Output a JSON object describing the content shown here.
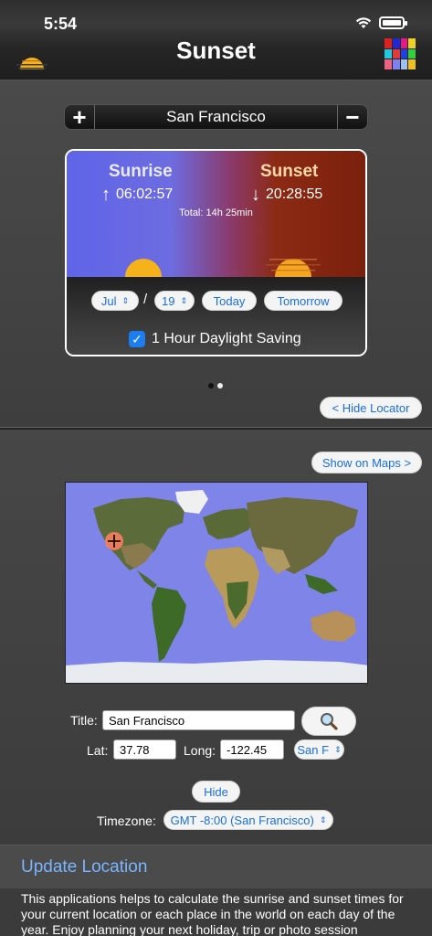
{
  "status": {
    "time": "5:54"
  },
  "nav": {
    "title": "Sunset"
  },
  "city": {
    "add_label": "+",
    "name": "San Francisco",
    "remove_label": "−"
  },
  "card": {
    "sunrise_label": "Sunrise",
    "sunrise_arrow": "↑",
    "sunrise_time": "06:02:57",
    "sunset_label": "Sunset",
    "sunset_arrow": "↓",
    "sunset_time": "20:28:55",
    "total": "Total: 14h 25min",
    "month": "Jul",
    "day": "19",
    "separator": "/",
    "today_label": "Today",
    "tomorrow_label": "Tomorrow",
    "dst_checked": true,
    "dst_label": "1 Hour Daylight Saving"
  },
  "page_indicator": {
    "count": 2,
    "current": 0
  },
  "hide_locator_label": "< Hide Locator",
  "show_on_maps_label": "Show on Maps >",
  "form": {
    "title_label": "Title:",
    "title_value": "San Francisco",
    "lat_label": "Lat:",
    "lat_value": "37.78",
    "long_label": "Long:",
    "long_value": "-122.45",
    "place_select": "San F",
    "hide_label": "Hide",
    "timezone_label": "Timezone:",
    "timezone_value": "GMT -8:00 (San Francisco)"
  },
  "update": {
    "title": "Update Location",
    "description": "This applications helps to calculate the sunrise and sunset times for your current location or each place in the world on each day of the year. Enjoy planning your next holiday, trip or photo session"
  },
  "colors": {
    "link_blue": "#1a6fe0",
    "update_title": "#7ab5ff",
    "map_ocean": "#7f84e8",
    "sunset_sky": "#8c2a14",
    "sunrise_sky": "#5f64e8"
  }
}
